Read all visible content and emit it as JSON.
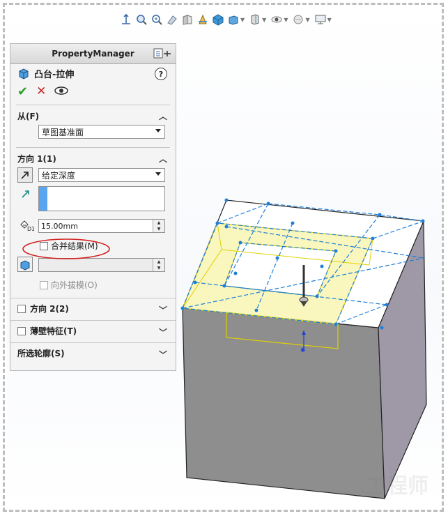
{
  "property_manager": {
    "header_title": "PropertyManager",
    "feature_title": "凸台-拉伸",
    "help_label": "?",
    "ok_label": "✔",
    "cancel_label": "✕",
    "preview_label": "👁",
    "from_group": {
      "label": "从(F)",
      "start_condition": "草图基准面"
    },
    "direction1_group": {
      "label": "方向 1(1)",
      "end_condition": "给定深度",
      "depth_value": "15.00mm",
      "merge_result_label": "合并结果(M)",
      "merge_result_checked": false,
      "draft_outward_label": "向外拔模(O)"
    },
    "collapsed_groups": [
      {
        "label": "方向 2(2)",
        "has_checkbox": true
      },
      {
        "label": "薄壁特征(T)",
        "has_checkbox": true
      },
      {
        "label": "所选轮廓(S)",
        "has_checkbox": false
      }
    ]
  },
  "toolbar": {
    "icons": [
      "zoom-fit-icon",
      "zoom-area-icon",
      "zoom-in-icon",
      "previous-view-icon",
      "section-view-icon",
      "view-orientation-icon",
      "display-style-icon",
      "hide-show-icon",
      "edit-appearance-icon",
      "scene-icon",
      "view-settings-icon",
      "monitor-icon"
    ]
  },
  "colors": {
    "highlight_yellow": "#f7f3a8",
    "sketch_blue": "#1e7fd8",
    "box_gray": "#8f8f8f",
    "annotation_red": "#d32020",
    "accent_blue": "#5aa5f0"
  },
  "watermark": "工程师"
}
